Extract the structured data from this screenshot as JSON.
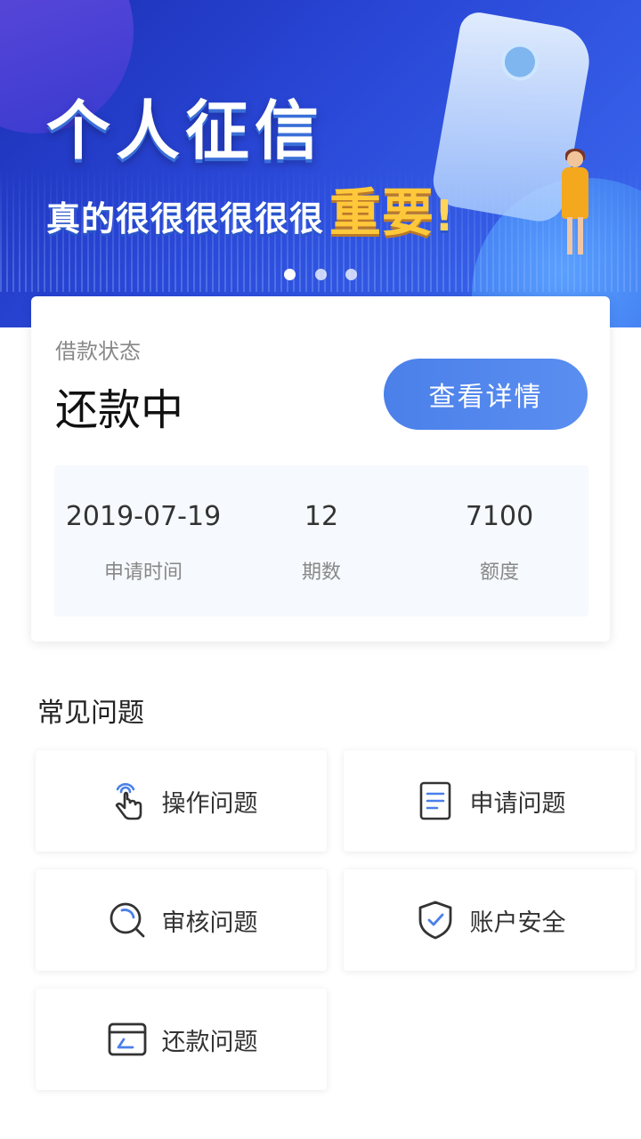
{
  "banner": {
    "title": "个人征信",
    "subtitle": "真的很很很很很很",
    "subtitle_accent": "重要",
    "subtitle_end": "!",
    "dots": 3,
    "active_dot": 0
  },
  "loan": {
    "label": "借款状态",
    "status": "还款中",
    "detail_button": "查看详情",
    "stats": [
      {
        "value": "2019-07-19",
        "label": "申请时间"
      },
      {
        "value": "12",
        "label": "期数"
      },
      {
        "value": "7100",
        "label": "额度"
      }
    ]
  },
  "faq": {
    "title": "常见问题",
    "items": [
      {
        "label": "操作问题",
        "icon": "tap-hand-icon"
      },
      {
        "label": "申请问题",
        "icon": "document-icon"
      },
      {
        "label": "审核问题",
        "icon": "search-icon"
      },
      {
        "label": "账户安全",
        "icon": "shield-check-icon"
      },
      {
        "label": "还款问题",
        "icon": "card-icon"
      }
    ]
  },
  "colors": {
    "accent": "#4b80ea",
    "icon_dark": "#333333",
    "icon_blue": "#4b80ea"
  }
}
